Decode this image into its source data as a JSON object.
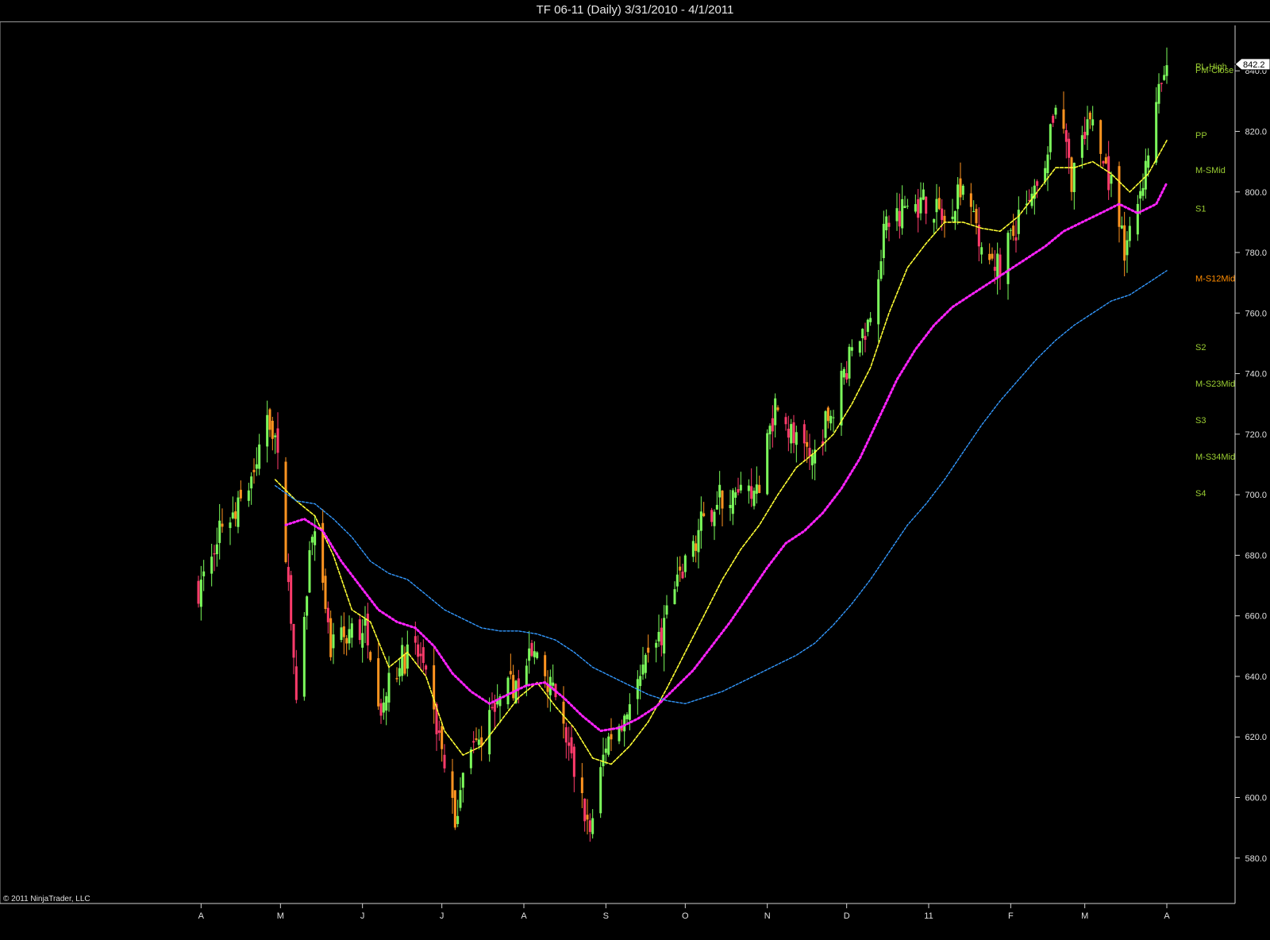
{
  "window": {
    "title": "TF 06-11 (Daily)  3/31/2010 - 4/1/2011"
  },
  "footer": {
    "copyright": "© 2011 NinjaTrader, LLC"
  },
  "colors": {
    "background": "#000000",
    "candle_up": "#7cfc5c",
    "candle_down": "#ff3b6b",
    "candle_weak_down": "#ff9420",
    "sma_fast": "#ffff33",
    "sma_mid": "#ff22ff",
    "sma_slow": "#3399ff",
    "pivot_green": "#9acd32",
    "pivot_orange": "#ff8c00"
  },
  "chart_data": {
    "type": "line",
    "title": "TF 06-11 (Daily)  3/31/2010 - 4/1/2011",
    "xlabel": "",
    "ylabel": "",
    "ylim": [
      565,
      855
    ],
    "xlim": [
      "2010-03-31",
      "2011-04-01"
    ],
    "grid": false,
    "y_ticks": [
      "580.0",
      "600.0",
      "620.0",
      "640.0",
      "660.0",
      "680.0",
      "700.0",
      "720.0",
      "740.0",
      "760.0",
      "780.0",
      "800.0",
      "820.0",
      "840.0"
    ],
    "x_ticks": [
      {
        "label": "A",
        "date": "2010-04-01"
      },
      {
        "label": "M",
        "date": "2010-05-01"
      },
      {
        "label": "J",
        "date": "2010-06-01"
      },
      {
        "label": "J",
        "date": "2010-07-01"
      },
      {
        "label": "A",
        "date": "2010-08-01"
      },
      {
        "label": "S",
        "date": "2010-09-01"
      },
      {
        "label": "O",
        "date": "2010-10-01"
      },
      {
        "label": "N",
        "date": "2010-11-01"
      },
      {
        "label": "D",
        "date": "2010-12-01"
      },
      {
        "label": "11",
        "date": "2011-01-01"
      },
      {
        "label": "F",
        "date": "2011-02-01"
      },
      {
        "label": "M",
        "date": "2011-03-01"
      },
      {
        "label": "A",
        "date": "2011-04-01"
      }
    ],
    "last_price": "842.2",
    "price_series": {
      "name": "TF 06-11 Close",
      "points": [
        [
          "2010-03-31",
          669
        ],
        [
          "2010-04-08",
          690
        ],
        [
          "2010-04-15",
          695
        ],
        [
          "2010-04-22",
          710
        ],
        [
          "2010-04-26",
          728
        ],
        [
          "2010-04-29",
          720
        ],
        [
          "2010-05-06",
          650
        ],
        [
          "2010-05-07",
          628
        ],
        [
          "2010-05-13",
          690
        ],
        [
          "2010-05-20",
          648
        ],
        [
          "2010-05-27",
          655
        ],
        [
          "2010-06-03",
          655
        ],
        [
          "2010-06-08",
          630
        ],
        [
          "2010-06-15",
          645
        ],
        [
          "2010-06-22",
          648
        ],
        [
          "2010-06-30",
          620
        ],
        [
          "2010-07-06",
          592
        ],
        [
          "2010-07-09",
          612
        ],
        [
          "2010-07-15",
          618
        ],
        [
          "2010-07-22",
          630
        ],
        [
          "2010-07-30",
          640
        ],
        [
          "2010-08-06",
          648
        ],
        [
          "2010-08-12",
          635
        ],
        [
          "2010-08-19",
          612
        ],
        [
          "2010-08-26",
          588
        ],
        [
          "2010-09-01",
          618
        ],
        [
          "2010-09-08",
          628
        ],
        [
          "2010-09-15",
          640
        ],
        [
          "2010-09-22",
          655
        ],
        [
          "2010-09-30",
          675
        ],
        [
          "2010-10-07",
          690
        ],
        [
          "2010-10-14",
          700
        ],
        [
          "2010-10-21",
          698
        ],
        [
          "2010-10-28",
          700
        ],
        [
          "2010-11-04",
          730
        ],
        [
          "2010-11-11",
          718
        ],
        [
          "2010-11-18",
          712
        ],
        [
          "2010-11-25",
          728
        ],
        [
          "2010-12-02",
          745
        ],
        [
          "2010-12-09",
          757
        ],
        [
          "2010-12-16",
          790
        ],
        [
          "2010-12-23",
          795
        ],
        [
          "2010-12-31",
          797
        ],
        [
          "2011-01-07",
          790
        ],
        [
          "2011-01-14",
          805
        ],
        [
          "2011-01-21",
          778
        ],
        [
          "2011-01-28",
          776
        ],
        [
          "2011-02-04",
          790
        ],
        [
          "2011-02-11",
          800
        ],
        [
          "2011-02-18",
          830
        ],
        [
          "2011-02-24",
          805
        ],
        [
          "2011-03-03",
          822
        ],
        [
          "2011-03-10",
          805
        ],
        [
          "2011-03-16",
          780
        ],
        [
          "2011-03-23",
          805
        ],
        [
          "2011-03-30",
          836
        ],
        [
          "2011-04-01",
          842.2
        ]
      ]
    },
    "series": [
      {
        "role": "sma_fast",
        "points": [
          [
            "2010-04-29",
            705
          ],
          [
            "2010-05-07",
            698
          ],
          [
            "2010-05-14",
            693
          ],
          [
            "2010-05-21",
            680
          ],
          [
            "2010-05-28",
            662
          ],
          [
            "2010-06-04",
            658
          ],
          [
            "2010-06-11",
            643
          ],
          [
            "2010-06-18",
            648
          ],
          [
            "2010-06-25",
            640
          ],
          [
            "2010-07-02",
            622
          ],
          [
            "2010-07-09",
            614
          ],
          [
            "2010-07-16",
            617
          ],
          [
            "2010-07-23",
            625
          ],
          [
            "2010-07-30",
            633
          ],
          [
            "2010-08-06",
            638
          ],
          [
            "2010-08-13",
            630
          ],
          [
            "2010-08-20",
            623
          ],
          [
            "2010-08-27",
            613
          ],
          [
            "2010-09-03",
            611
          ],
          [
            "2010-09-10",
            617
          ],
          [
            "2010-09-17",
            625
          ],
          [
            "2010-09-24",
            636
          ],
          [
            "2010-10-01",
            648
          ],
          [
            "2010-10-08",
            660
          ],
          [
            "2010-10-15",
            672
          ],
          [
            "2010-10-22",
            682
          ],
          [
            "2010-10-29",
            690
          ],
          [
            "2010-11-05",
            700
          ],
          [
            "2010-11-12",
            709
          ],
          [
            "2010-11-19",
            714
          ],
          [
            "2010-11-26",
            720
          ],
          [
            "2010-12-03",
            730
          ],
          [
            "2010-12-10",
            742
          ],
          [
            "2010-12-17",
            760
          ],
          [
            "2010-12-24",
            775
          ],
          [
            "2010-12-31",
            783
          ],
          [
            "2011-01-07",
            790
          ],
          [
            "2011-01-14",
            790
          ],
          [
            "2011-01-21",
            788
          ],
          [
            "2011-01-28",
            787
          ],
          [
            "2011-02-04",
            792
          ],
          [
            "2011-02-11",
            800
          ],
          [
            "2011-02-18",
            808
          ],
          [
            "2011-02-25",
            808
          ],
          [
            "2011-03-04",
            810
          ],
          [
            "2011-03-11",
            806
          ],
          [
            "2011-03-18",
            800
          ],
          [
            "2011-03-25",
            806
          ],
          [
            "2011-04-01",
            817
          ]
        ]
      },
      {
        "role": "sma_mid",
        "points": [
          [
            "2010-05-03",
            690
          ],
          [
            "2010-05-10",
            692
          ],
          [
            "2010-05-17",
            688
          ],
          [
            "2010-05-24",
            678
          ],
          [
            "2010-05-31",
            670
          ],
          [
            "2010-06-07",
            662
          ],
          [
            "2010-06-14",
            658
          ],
          [
            "2010-06-21",
            656
          ],
          [
            "2010-06-28",
            650
          ],
          [
            "2010-07-05",
            641
          ],
          [
            "2010-07-12",
            635
          ],
          [
            "2010-07-19",
            631
          ],
          [
            "2010-07-26",
            634
          ],
          [
            "2010-08-02",
            637
          ],
          [
            "2010-08-09",
            638
          ],
          [
            "2010-08-16",
            633
          ],
          [
            "2010-08-23",
            627
          ],
          [
            "2010-08-30",
            622
          ],
          [
            "2010-09-06",
            623
          ],
          [
            "2010-09-13",
            626
          ],
          [
            "2010-09-20",
            630
          ],
          [
            "2010-09-27",
            636
          ],
          [
            "2010-10-04",
            642
          ],
          [
            "2010-10-11",
            650
          ],
          [
            "2010-10-18",
            658
          ],
          [
            "2010-10-25",
            667
          ],
          [
            "2010-11-01",
            676
          ],
          [
            "2010-11-08",
            684
          ],
          [
            "2010-11-15",
            688
          ],
          [
            "2010-11-22",
            694
          ],
          [
            "2010-11-29",
            702
          ],
          [
            "2010-12-06",
            712
          ],
          [
            "2010-12-13",
            725
          ],
          [
            "2010-12-20",
            738
          ],
          [
            "2010-12-27",
            748
          ],
          [
            "2011-01-03",
            756
          ],
          [
            "2011-01-10",
            762
          ],
          [
            "2011-01-17",
            766
          ],
          [
            "2011-01-24",
            770
          ],
          [
            "2011-01-31",
            774
          ],
          [
            "2011-02-07",
            778
          ],
          [
            "2011-02-14",
            782
          ],
          [
            "2011-02-21",
            787
          ],
          [
            "2011-02-28",
            790
          ],
          [
            "2011-03-07",
            793
          ],
          [
            "2011-03-14",
            796
          ],
          [
            "2011-03-21",
            793
          ],
          [
            "2011-03-28",
            796
          ],
          [
            "2011-04-01",
            803
          ]
        ]
      },
      {
        "role": "sma_slow",
        "points": [
          [
            "2010-04-29",
            703
          ],
          [
            "2010-05-07",
            698
          ],
          [
            "2010-05-14",
            697
          ],
          [
            "2010-05-21",
            692
          ],
          [
            "2010-05-28",
            686
          ],
          [
            "2010-06-04",
            678
          ],
          [
            "2010-06-11",
            674
          ],
          [
            "2010-06-18",
            672
          ],
          [
            "2010-06-25",
            667
          ],
          [
            "2010-07-02",
            662
          ],
          [
            "2010-07-09",
            659
          ],
          [
            "2010-07-16",
            656
          ],
          [
            "2010-07-23",
            655
          ],
          [
            "2010-07-30",
            655
          ],
          [
            "2010-08-06",
            654
          ],
          [
            "2010-08-13",
            652
          ],
          [
            "2010-08-20",
            648
          ],
          [
            "2010-08-27",
            643
          ],
          [
            "2010-09-03",
            640
          ],
          [
            "2010-09-10",
            637
          ],
          [
            "2010-09-17",
            634
          ],
          [
            "2010-09-24",
            632
          ],
          [
            "2010-10-01",
            631
          ],
          [
            "2010-10-08",
            633
          ],
          [
            "2010-10-15",
            635
          ],
          [
            "2010-10-22",
            638
          ],
          [
            "2010-10-29",
            641
          ],
          [
            "2010-11-05",
            644
          ],
          [
            "2010-11-12",
            647
          ],
          [
            "2010-11-19",
            651
          ],
          [
            "2010-11-26",
            657
          ],
          [
            "2010-12-03",
            664
          ],
          [
            "2010-12-10",
            672
          ],
          [
            "2010-12-17",
            681
          ],
          [
            "2010-12-24",
            690
          ],
          [
            "2010-12-31",
            697
          ],
          [
            "2011-01-07",
            705
          ],
          [
            "2011-01-14",
            714
          ],
          [
            "2011-01-21",
            723
          ],
          [
            "2011-01-28",
            731
          ],
          [
            "2011-02-04",
            738
          ],
          [
            "2011-02-11",
            745
          ],
          [
            "2011-02-18",
            751
          ],
          [
            "2011-02-25",
            756
          ],
          [
            "2011-03-04",
            760
          ],
          [
            "2011-03-11",
            764
          ],
          [
            "2011-03-18",
            766
          ],
          [
            "2011-03-25",
            770
          ],
          [
            "2011-04-01",
            774
          ]
        ]
      }
    ],
    "pivot_levels": [
      {
        "label": "PL-High",
        "value": 841.5,
        "color": "#9acd32"
      },
      {
        "label": "PM-Close",
        "value": 840.3,
        "color": "#9acd32"
      },
      {
        "label": "PP",
        "value": 818.8,
        "color": "#9acd32"
      },
      {
        "label": "M-SMid",
        "value": 807.3,
        "color": "#9acd32"
      },
      {
        "label": "S1",
        "value": 794.6,
        "color": "#9acd32"
      },
      {
        "label": "M-S12Mid",
        "value": 771.5,
        "color": "#ff8c00"
      },
      {
        "label": "S2",
        "value": 748.8,
        "color": "#9acd32"
      },
      {
        "label": "M-S23Mid",
        "value": 736.7,
        "color": "#9acd32"
      },
      {
        "label": "S3",
        "value": 724.7,
        "color": "#9acd32"
      },
      {
        "label": "M-S34Mid",
        "value": 712.6,
        "color": "#9acd32"
      },
      {
        "label": "S4",
        "value": 700.6,
        "color": "#9acd32"
      }
    ]
  }
}
